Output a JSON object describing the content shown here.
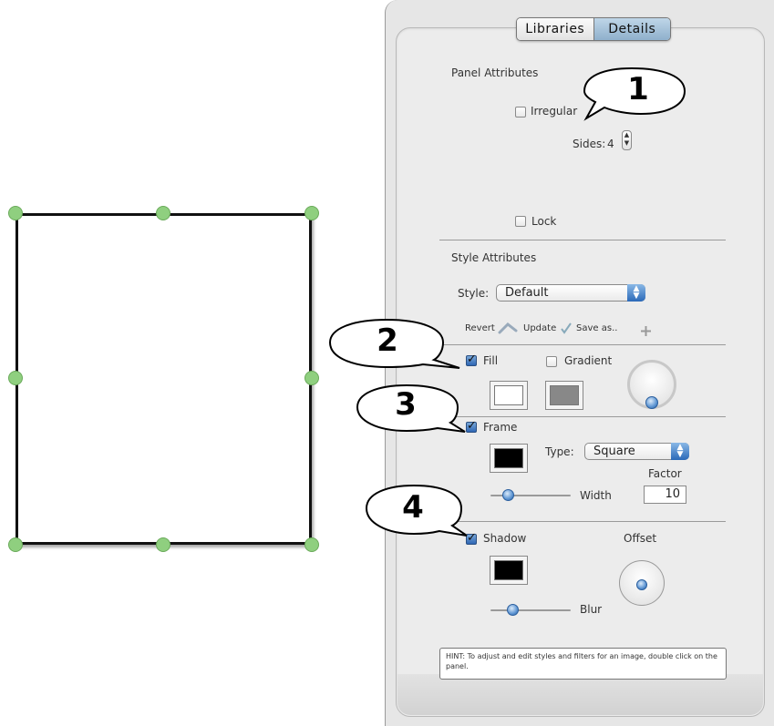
{
  "canvas": {
    "shape": "rectangle-panel"
  },
  "tabs": {
    "libraries": "Libraries",
    "details": "Details"
  },
  "panel_attributes": {
    "heading": "Panel Attributes",
    "irregular_label": "Irregular",
    "irregular_checked": false,
    "sides_label": "Sides:",
    "sides_value": "4",
    "lock_label": "Lock",
    "lock_checked": false
  },
  "style_attributes": {
    "heading": "Style Attributes",
    "style_label": "Style:",
    "style_value": "Default",
    "revert_label": "Revert",
    "update_label": "Update",
    "save_as_label": "Save as.."
  },
  "fill": {
    "label": "Fill",
    "checked": true,
    "gradient_label": "Gradient",
    "gradient_checked": false,
    "color": "#ffffff",
    "gradient_color": "#888888"
  },
  "frame": {
    "label": "Frame",
    "checked": true,
    "color": "#000000",
    "type_label": "Type:",
    "type_value": "Square",
    "factor_label": "Factor",
    "factor_value": "10",
    "width_label": "Width"
  },
  "shadow": {
    "label": "Shadow",
    "checked": true,
    "color": "#000000",
    "offset_label": "Offset",
    "blur_label": "Blur"
  },
  "hint": "HINT: To adjust and edit styles and filters for an image, double click on the panel.",
  "callouts": [
    "1",
    "2",
    "3",
    "4"
  ]
}
